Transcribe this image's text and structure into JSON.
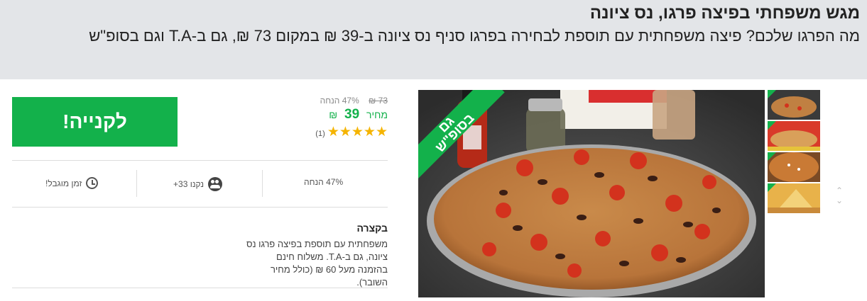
{
  "header": {
    "title": "מגש משפחתי בפיצה פרגו, נס ציונה",
    "subtitle": "מה הפרגו שלכם? פיצה משפחתית עם תוספת לבחירה בפרגו סניף נס ציונה ב-39 ₪ במקום 73 ₪, גם ב-T.A וגם בסופ\"ש"
  },
  "image": {
    "ribbon_line1": "גם",
    "ribbon_line2": "בסופ\"ש"
  },
  "buy": {
    "label": "לקנייה!"
  },
  "price": {
    "old_price": "73 ₪",
    "discount": "47% הנחה",
    "label": "מחיר",
    "value": "39",
    "currency": "₪",
    "rating": 5,
    "stars": "★★★★★",
    "reviews": "(1)"
  },
  "stats": {
    "discount": "47% הנחה",
    "bought": "נקנו 33+",
    "limited": "זמן מוגבל!"
  },
  "brief": {
    "heading": "בקצרה",
    "text": "משפחתית עם תוספת בפיצה פרגו נס ציונה, גם ב-T.A. משלוח חינם בהזמנה מעל 60 ₪ (כולל מחיר השובר)."
  },
  "thumb_nav": {
    "up": "⌃",
    "down": "⌄"
  },
  "colors": {
    "accent": "#13b14b",
    "header_bg": "#e3e5e8",
    "star": "#f5b400"
  }
}
